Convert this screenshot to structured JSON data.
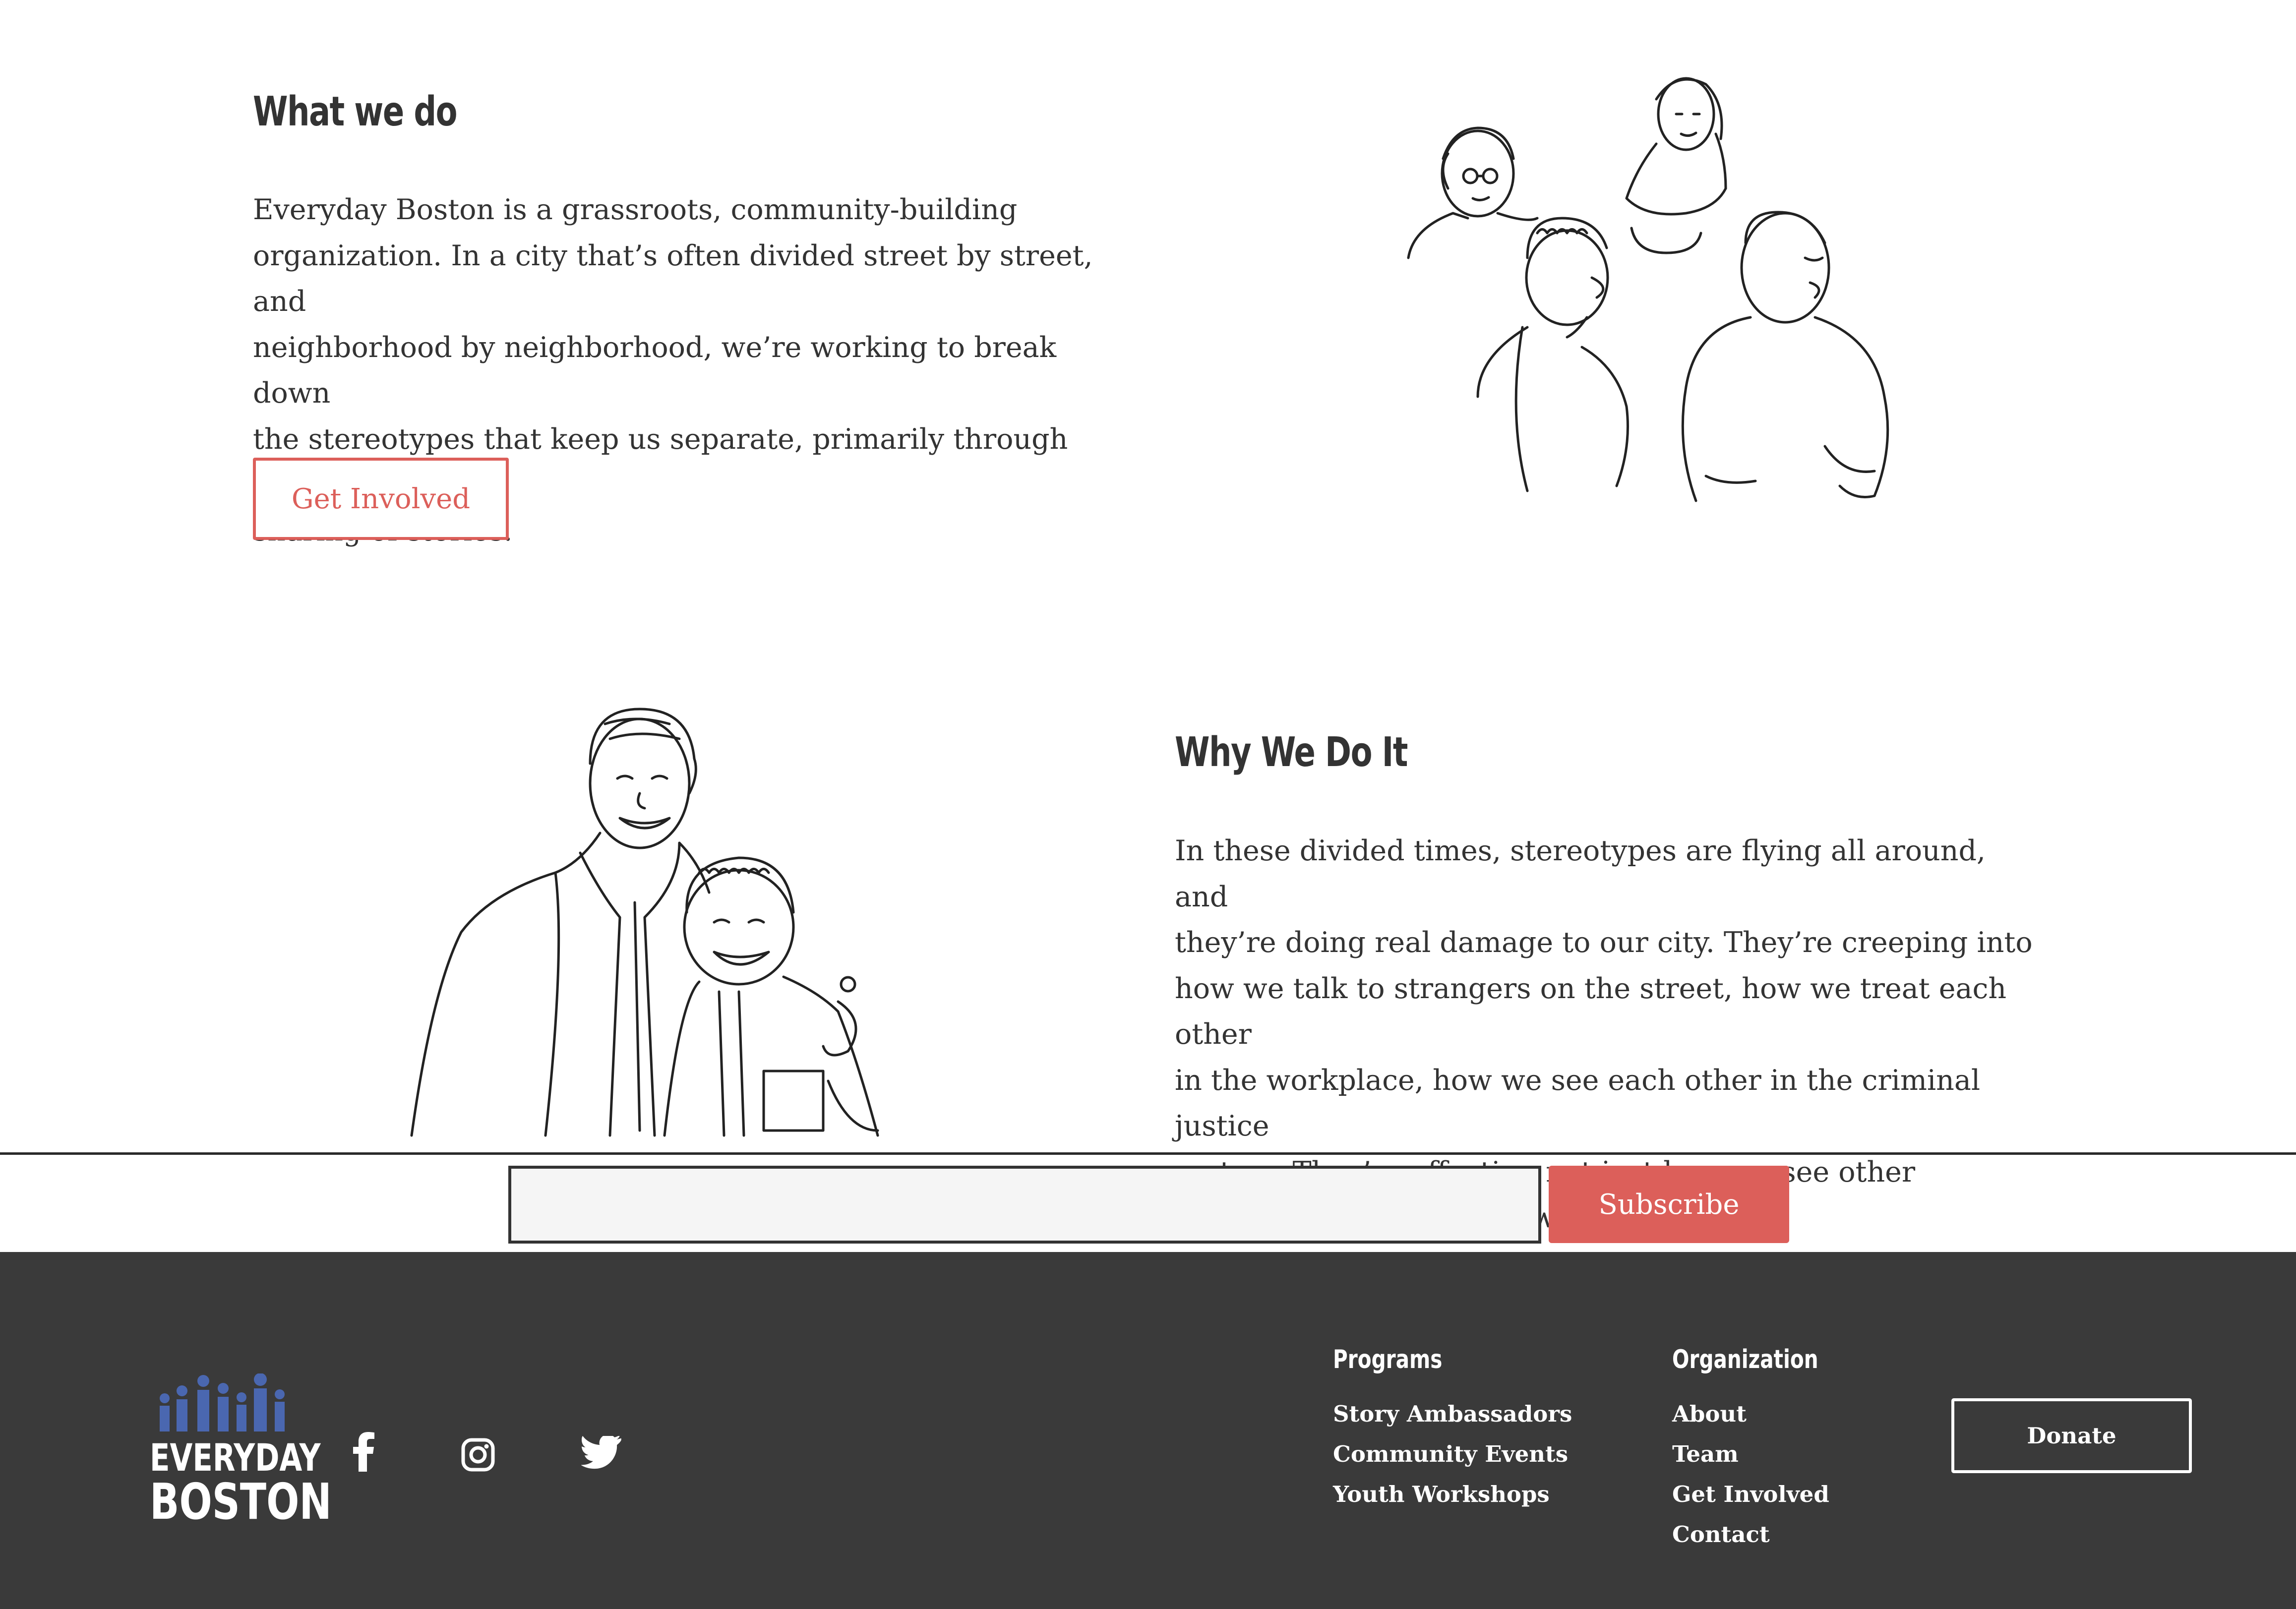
{
  "colors": {
    "accent": "#dc5f5a",
    "footer_bg": "#3a3a3a",
    "text": "#333333",
    "logo_blue": "#4a67b0"
  },
  "what": {
    "title": "What we do",
    "lines": [
      "Everyday Boston is a grassroots, community-building",
      "organization. In a city that’s often divided street by street, and",
      "neighborhood by neighborhood, we’re working to break down",
      "the stereotypes that keep us separate, primarily through the",
      "sharing of stories."
    ],
    "button": "Get Involved"
  },
  "why": {
    "title": "Why We Do It",
    "lines": [
      "In these divided times, stereotypes are flying all around, and",
      "they’re doing real damage to our city. They’re creeping into",
      "how we talk to strangers on the street, how we treat each other",
      "in the workplace, how we see each other in the criminal justice",
      "system. They’re affecting not just how we see other",
      "neighborhoods, but how we see our own."
    ]
  },
  "newsletter": {
    "email_value": "",
    "subscribe": "Subscribe"
  },
  "footer": {
    "logo": {
      "line1": "EVERYDAY",
      "line2": "BOSTON"
    },
    "social": [
      "facebook-icon",
      "instagram-icon",
      "twitter-icon"
    ],
    "programs": {
      "heading": "Programs",
      "items": [
        "Story Ambassadors",
        "Community Events",
        "Youth Workshops"
      ]
    },
    "organization": {
      "heading": "Organization",
      "items": [
        "About",
        "Team",
        "Get Involved",
        "Contact"
      ]
    },
    "donate": "Donate"
  }
}
